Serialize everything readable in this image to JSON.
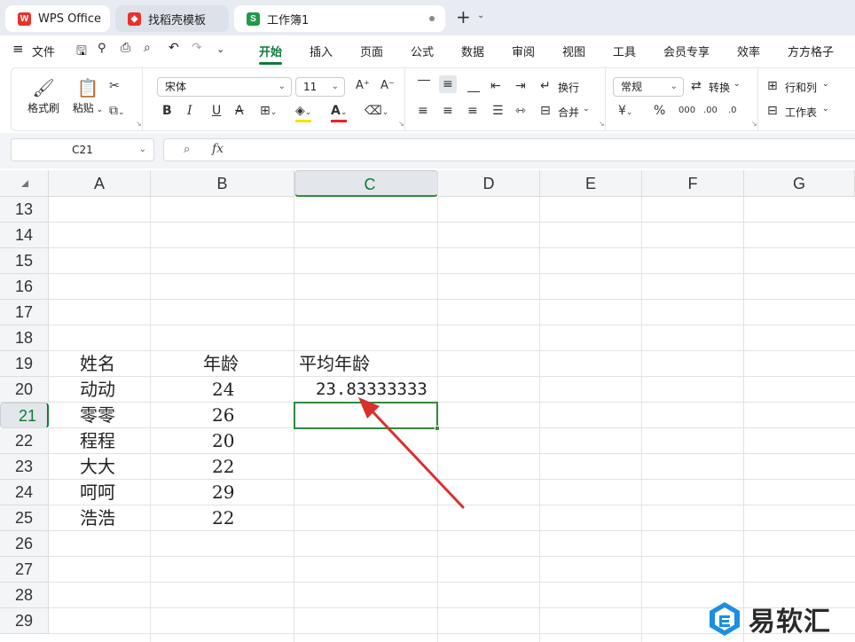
{
  "tabs": {
    "wps": "WPS Office",
    "templates": "找稻壳模板",
    "workbook": "工作簿1"
  },
  "menu": {
    "file": "文件",
    "items": [
      "开始",
      "插入",
      "页面",
      "公式",
      "数据",
      "审阅",
      "视图",
      "工具",
      "会员专享",
      "效率",
      "方方格子"
    ]
  },
  "ribbon": {
    "format_painter": "格式刷",
    "paste": "粘贴",
    "font_name": "宋体",
    "font_size": "11",
    "wrap": "换行",
    "merge": "合并",
    "number_format": "常规",
    "convert": "转换",
    "rows_cols": "行和列",
    "worksheet": "工作表"
  },
  "formula_bar": {
    "name_box": "C21",
    "fx": "fx",
    "value": ""
  },
  "sheet": {
    "columns": [
      "A",
      "B",
      "C",
      "D",
      "E",
      "F",
      "G"
    ],
    "selected_column": "C",
    "rows": [
      "13",
      "14",
      "15",
      "16",
      "17",
      "18",
      "19",
      "20",
      "21",
      "22",
      "23",
      "24",
      "25",
      "26",
      "27",
      "28",
      "29"
    ],
    "selected_row": "21",
    "cells": {
      "A19": "姓名",
      "B19": "年龄",
      "C19": "平均年龄",
      "A20": "动动",
      "B20": "24",
      "C20": "23.83333333",
      "A21": "零零",
      "B21": "26",
      "A22": "程程",
      "B22": "20",
      "A23": "大大",
      "B23": "22",
      "A24": "呵呵",
      "B24": "29",
      "A25": "浩浩",
      "B25": "22"
    }
  },
  "watermark": "易软汇",
  "colors": {
    "accent": "#0d7a3a",
    "selection": "#2e8b3a",
    "arrow": "#d9302c"
  }
}
